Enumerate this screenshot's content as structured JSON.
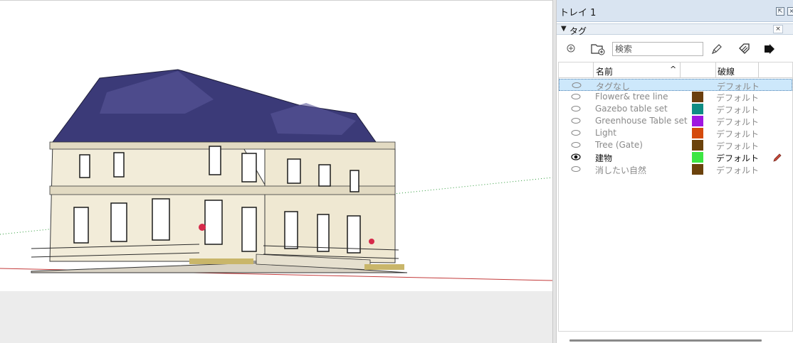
{
  "tray": {
    "title": "トレイ 1",
    "pin_label": "⇱",
    "close_label": "×"
  },
  "panel": {
    "title": "タグ",
    "collapse_arrow": "▼",
    "close_label": "×"
  },
  "toolbar": {
    "icons": [
      "add-tag-icon",
      "add-folder-icon",
      "paint-by-tag-icon",
      "purge-tags-icon",
      "details-icon"
    ],
    "search_placeholder": "検索"
  },
  "table": {
    "columns": {
      "name": "名前",
      "sort_arrow": "^",
      "dash": "破線"
    },
    "rows": [
      {
        "name": "タグなし",
        "color": "",
        "dash": "デフォルト",
        "visible": false,
        "selected": true,
        "active": false
      },
      {
        "name": "Flower& tree line",
        "color": "#6b3f0e",
        "dash": "デフォルト",
        "visible": false,
        "selected": false,
        "active": false
      },
      {
        "name": "Gazebo table set",
        "color": "#0f8d84",
        "dash": "デフォルト",
        "visible": false,
        "selected": false,
        "active": false
      },
      {
        "name": "Greenhouse Table set",
        "color": "#9f17e0",
        "dash": "デフォルト",
        "visible": false,
        "selected": false,
        "active": false
      },
      {
        "name": "Light",
        "color": "#d44a0c",
        "dash": "デフォルト",
        "visible": false,
        "selected": false,
        "active": false
      },
      {
        "name": "Tree (Gate)",
        "color": "#6b420c",
        "dash": "デフォルト",
        "visible": false,
        "selected": false,
        "active": false
      },
      {
        "name": "建物",
        "color": "#3ce643",
        "dash": "デフォルト",
        "visible": true,
        "selected": false,
        "active": true
      },
      {
        "name": "消したい自然",
        "color": "#6b420c",
        "dash": "デフォルト",
        "visible": false,
        "selected": false,
        "active": false
      }
    ]
  }
}
